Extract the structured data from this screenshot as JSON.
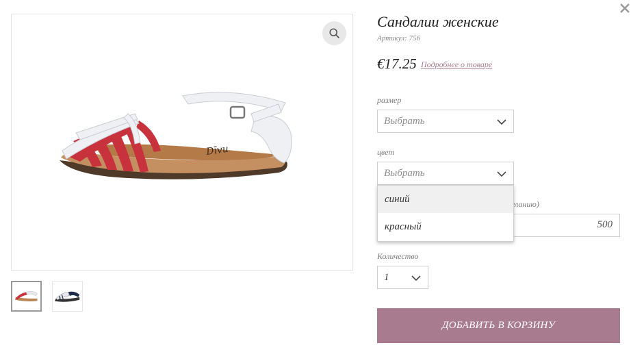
{
  "product": {
    "title": "Сандалии женские",
    "sku": "Артикул: 756",
    "price": "€17.25",
    "details_link": "Подробнее о товаре"
  },
  "size": {
    "label": "размер",
    "value": "Выбрать"
  },
  "color": {
    "label": "цвет",
    "value": "Выбрать",
    "options": [
      "синий",
      "красный"
    ]
  },
  "custom": {
    "label_partial": "желанию)",
    "value": "500"
  },
  "quantity": {
    "label": "Количество",
    "value": "1"
  },
  "add_to_cart": "ДОБАВИТЬ В КОРЗИНУ",
  "icons": [
    "close-icon",
    "magnifier-icon",
    "chevron-down-icon"
  ],
  "colors": {
    "accent": "#a87b8e",
    "strap_red": "#c8323c",
    "strap_white": "#eef0f4",
    "sole": "#b98655"
  }
}
